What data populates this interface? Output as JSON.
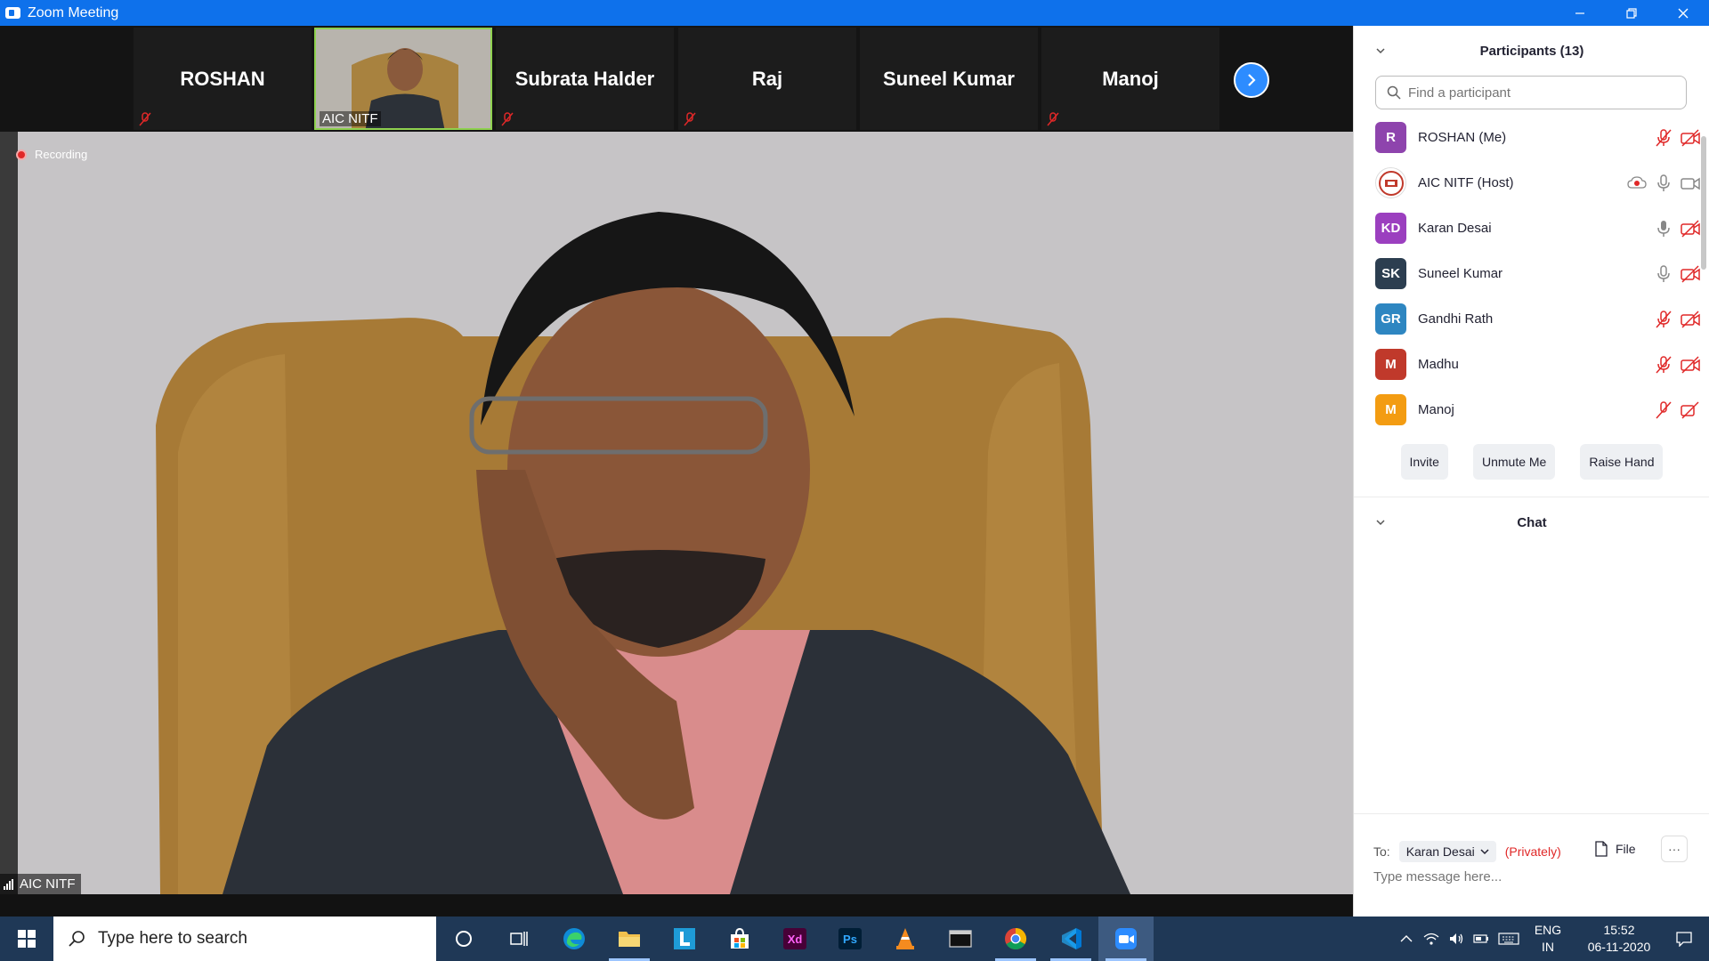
{
  "window": {
    "title": "Zoom Meeting"
  },
  "strip": {
    "tiles": [
      {
        "name": "ROSHAN",
        "muted": true
      },
      {
        "name": "AIC NITF",
        "video": true
      },
      {
        "name": "Subrata Halder",
        "muted": true
      },
      {
        "name": "Raj",
        "muted": true
      },
      {
        "name": "Suneel Kumar",
        "muted": false
      },
      {
        "name": "Manoj",
        "muted": true
      }
    ]
  },
  "main_video": {
    "recording_label": "Recording",
    "speaker_label": "AIC NITF"
  },
  "participants": {
    "title": "Participants (13)",
    "search_placeholder": "Find a participant",
    "list": [
      {
        "initials": "R",
        "name": "ROSHAN (Me)",
        "color": "#8e44ad",
        "mic": "muted",
        "video": "off"
      },
      {
        "initials": "",
        "name": "AIC NITF (Host)",
        "color": "#ffffff",
        "mic": "on",
        "video": "on",
        "recording": true
      },
      {
        "initials": "KD",
        "name": "Karan Desai",
        "color": "#9b3fbf",
        "mic": "on",
        "video": "off"
      },
      {
        "initials": "SK",
        "name": "Suneel Kumar",
        "color": "#2c3e50",
        "mic": "on",
        "video": "off"
      },
      {
        "initials": "GR",
        "name": "Gandhi Rath",
        "color": "#2e86c1",
        "mic": "muted",
        "video": "off"
      },
      {
        "initials": "M",
        "name": "Madhu",
        "color": "#c0392b",
        "mic": "muted",
        "video": "off"
      },
      {
        "initials": "M",
        "name": "Manoj",
        "color": "#f39c12",
        "mic": "muted",
        "video": "off"
      }
    ],
    "buttons": {
      "invite": "Invite",
      "unmute": "Unmute Me",
      "raise_hand": "Raise Hand"
    }
  },
  "chat": {
    "title": "Chat",
    "to_label": "To:",
    "recipient": "Karan Desai",
    "privately": "(Privately)",
    "file_label": "File",
    "more_label": "···",
    "input_placeholder": "Type message here..."
  },
  "taskbar": {
    "search_placeholder": "Type here to search",
    "apps": [
      "cortana",
      "task-view",
      "edge",
      "file-explorer",
      "l-app",
      "store",
      "adobe-xd",
      "photoshop",
      "vlc",
      "terminal",
      "chrome",
      "vscode",
      "zoom"
    ],
    "lang_top": "ENG",
    "lang_bottom": "IN",
    "time": "15:52",
    "date": "06-11-2020"
  },
  "colors": {
    "titlebar": "#0e71eb",
    "accent": "#2d8cff",
    "muted_red": "#e02828",
    "taskbar": "#1f3856"
  }
}
